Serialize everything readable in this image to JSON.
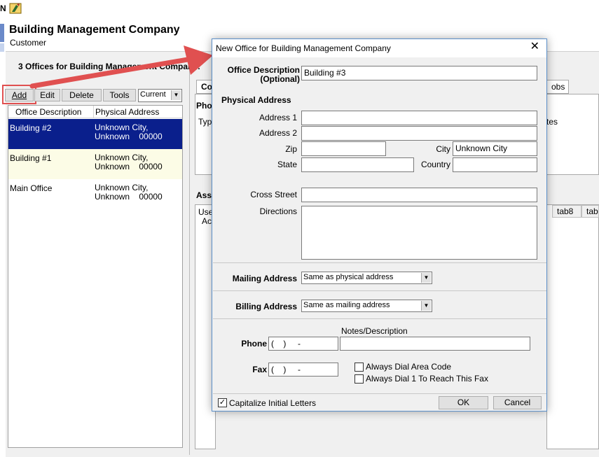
{
  "app": {
    "company_name": "Building Management Company",
    "company_type": "Customer",
    "offices_heading": "3 Offices for Building Management Company:"
  },
  "toolbar": {
    "add_label": "Add",
    "edit_label": "Edit",
    "delete_label": "Delete",
    "tools_label": "Tools",
    "filter_value": "Current"
  },
  "office_list": {
    "columns": [
      "Office Description",
      "Physical Address"
    ],
    "rows": [
      {
        "description": "Building #2",
        "address_line1": "Unknown City,",
        "address_line2": "Unknown    00000",
        "selected": true
      },
      {
        "description": "Building #1",
        "address_line1": "Unknown City,",
        "address_line2": "Unknown    00000",
        "selected": false
      },
      {
        "description": "Main Office",
        "address_line1": "Unknown City,",
        "address_line2": "Unknown    00000",
        "selected": false
      }
    ]
  },
  "background_fragments": {
    "tab_co": "Co",
    "pho": "Pho",
    "typ": "Typ",
    "ass": "Ass",
    "use": "Use",
    "ac": "Ac",
    "jobs_tab": "obs",
    "tes": "tes",
    "tab8": "tab8",
    "tab9": "tab"
  },
  "dialog": {
    "title": "New Office for Building Management Company",
    "office_description_label_1": "Office Description",
    "office_description_label_2": "(Optional)",
    "office_description_value": "Building #3",
    "physical_address_heading": "Physical Address",
    "address1_label": "Address 1",
    "address2_label": "Address 2",
    "zip_label": "Zip",
    "city_label": "City",
    "city_value": "Unknown City",
    "state_label": "State",
    "country_label": "Country",
    "cross_street_label": "Cross Street",
    "directions_label": "Directions",
    "mailing_address_label": "Mailing Address",
    "mailing_address_value": "Same as physical address",
    "billing_address_label": "Billing Address",
    "billing_address_value": "Same as mailing address",
    "notes_label": "Notes/Description",
    "phone_label": "Phone",
    "phone_value": "(    )     -",
    "fax_label": "Fax",
    "fax_value": "(    )     -",
    "always_dial_area_code": "Always Dial Area Code",
    "always_dial_1": "Always Dial 1 To Reach This Fax",
    "capitalize_label": "Capitalize Initial Letters",
    "capitalize_checked": true,
    "ok_label": "OK",
    "cancel_label": "Cancel"
  },
  "colors": {
    "selection": "#0a1f8c",
    "annotation_arrow": "#e05050",
    "dialog_border": "#5b8fc9"
  }
}
